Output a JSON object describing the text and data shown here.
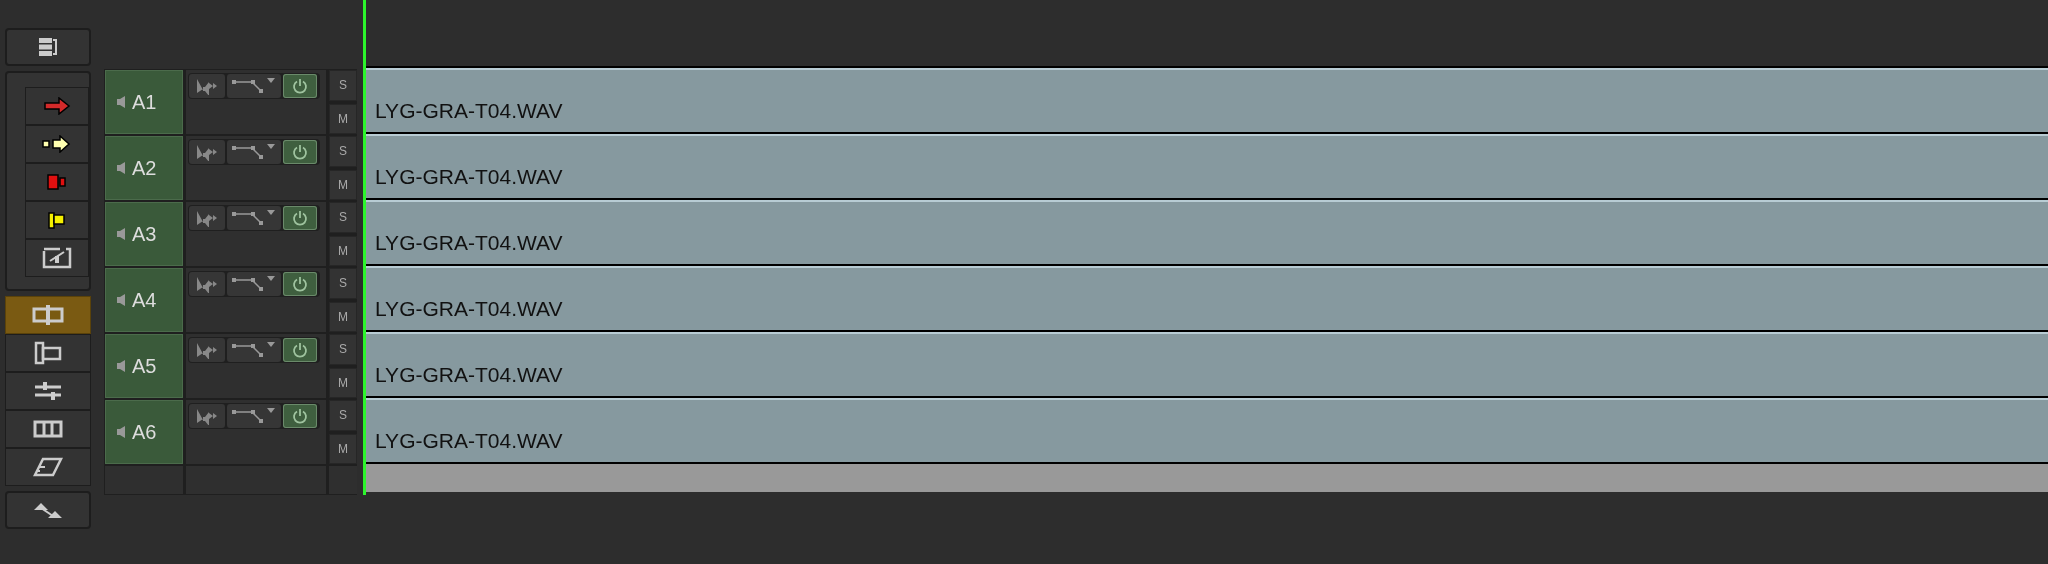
{
  "toolbar": {
    "top": {
      "kind": "track-list"
    },
    "group": [
      {
        "kind": "red-arrow"
      },
      {
        "kind": "yellow-arrow"
      },
      {
        "kind": "red-mark"
      },
      {
        "kind": "yellow-mark"
      },
      {
        "kind": "frame"
      }
    ],
    "modes": [
      {
        "kind": "split",
        "selected": true
      },
      {
        "kind": "panel",
        "selected": false
      },
      {
        "kind": "sliders",
        "selected": false
      },
      {
        "kind": "cells",
        "selected": false
      },
      {
        "kind": "film",
        "selected": false
      }
    ],
    "bottom": {
      "kind": "zoom"
    }
  },
  "tracks": [
    {
      "name": "A1",
      "clip": "LYG-GRA-T04.WAV",
      "enabled": true,
      "solo_label": "S",
      "solo": false,
      "mute_label": "M",
      "mute": false
    },
    {
      "name": "A2",
      "clip": "LYG-GRA-T04.WAV",
      "enabled": true,
      "solo_label": "S",
      "solo": false,
      "mute_label": "M",
      "mute": false
    },
    {
      "name": "A3",
      "clip": "LYG-GRA-T04.WAV",
      "enabled": true,
      "solo_label": "S",
      "solo": false,
      "mute_label": "M",
      "mute": false
    },
    {
      "name": "A4",
      "clip": "LYG-GRA-T04.WAV",
      "enabled": true,
      "solo_label": "S",
      "solo": false,
      "mute_label": "M",
      "mute": false
    },
    {
      "name": "A5",
      "clip": "LYG-GRA-T04.WAV",
      "enabled": true,
      "solo_label": "S",
      "solo": false,
      "mute_label": "M",
      "mute": false
    },
    {
      "name": "A6",
      "clip": "LYG-GRA-T04.WAV",
      "enabled": true,
      "solo_label": "S",
      "solo": false,
      "mute_label": "M",
      "mute": false
    }
  ]
}
